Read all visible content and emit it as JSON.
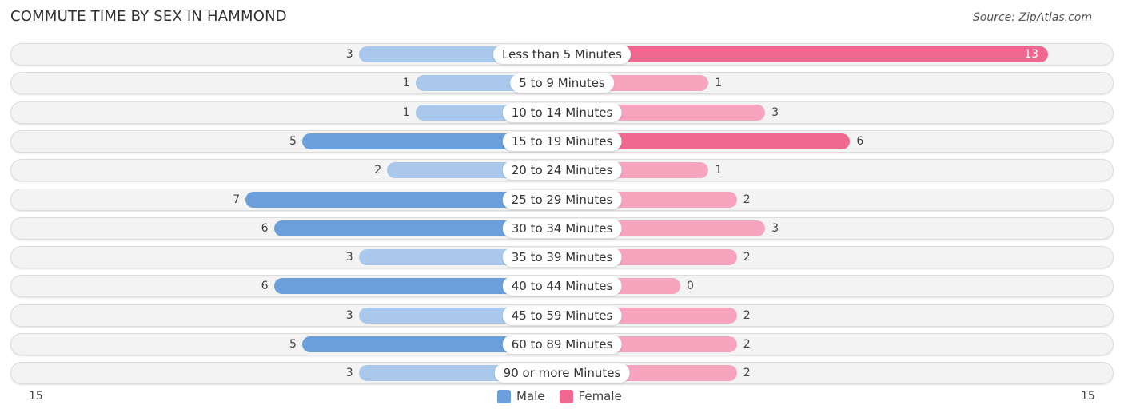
{
  "title": "COMMUTE TIME BY SEX IN HAMMOND",
  "source": "Source: ZipAtlas.com",
  "colors": {
    "male_strong": "#6a9fdb",
    "male_light": "#a9c8ec",
    "female_strong": "#f06890",
    "female_light": "#f7a4bf"
  },
  "chart_data": {
    "type": "bar",
    "orientation": "horizontal-diverging",
    "title": "COMMUTE TIME BY SEX IN HAMMOND",
    "categories": [
      "Less than 5 Minutes",
      "5 to 9 Minutes",
      "10 to 14 Minutes",
      "15 to 19 Minutes",
      "20 to 24 Minutes",
      "25 to 29 Minutes",
      "30 to 34 Minutes",
      "35 to 39 Minutes",
      "40 to 44 Minutes",
      "45 to 59 Minutes",
      "60 to 89 Minutes",
      "90 or more Minutes"
    ],
    "series": [
      {
        "name": "Male",
        "values": [
          3,
          1,
          1,
          5,
          2,
          7,
          6,
          3,
          6,
          3,
          5,
          3
        ]
      },
      {
        "name": "Female",
        "values": [
          13,
          1,
          3,
          6,
          1,
          2,
          3,
          2,
          0,
          2,
          2,
          2
        ]
      }
    ],
    "axis": {
      "left_label": "15",
      "right_label": "15",
      "max": 15
    },
    "legend": [
      "Male",
      "Female"
    ],
    "legend_position": "bottom-center"
  }
}
